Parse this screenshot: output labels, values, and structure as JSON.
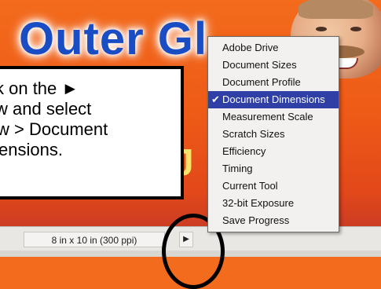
{
  "banner": {
    "headline": "Outer Gl",
    "mid1": "8",
    "mid2": "J"
  },
  "callout": {
    "lines": [
      "k on the ►",
      "w and select",
      "w > Document",
      "ensions."
    ]
  },
  "statusbar": {
    "readout": "8 in x 10 in (300 ppi)",
    "arrow_icon": "triangle-right-icon",
    "arrow_glyph": "▶"
  },
  "menu": {
    "items": [
      {
        "label": "Adobe Drive",
        "checked": false
      },
      {
        "label": "Document Sizes",
        "checked": false
      },
      {
        "label": "Document Profile",
        "checked": false
      },
      {
        "label": "Document Dimensions",
        "checked": true
      },
      {
        "label": "Measurement Scale",
        "checked": false
      },
      {
        "label": "Scratch Sizes",
        "checked": false
      },
      {
        "label": "Efficiency",
        "checked": false
      },
      {
        "label": "Timing",
        "checked": false
      },
      {
        "label": "Current Tool",
        "checked": false
      },
      {
        "label": "32-bit Exposure",
        "checked": false
      },
      {
        "label": "Save Progress",
        "checked": false
      }
    ],
    "check_glyph": "✔"
  },
  "colors": {
    "menu_highlight": "#2f3fa6",
    "headline": "#1a4dc4",
    "background": "#f36b1c"
  }
}
